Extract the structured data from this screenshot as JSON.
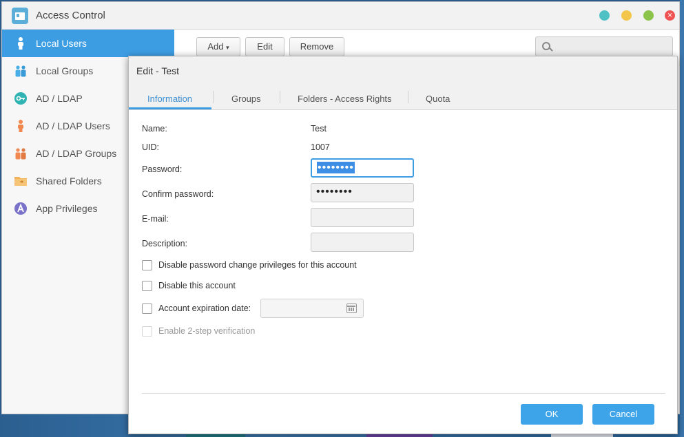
{
  "app": {
    "title": "Access Control"
  },
  "window_controls": {
    "colors": [
      "#4fc1c5",
      "#f3c54a",
      "#8cc34a",
      "#ef5454"
    ],
    "close_glyph": "✕"
  },
  "sidebar": {
    "items": [
      {
        "label": "Local Users",
        "icon": "user-icon",
        "active": true
      },
      {
        "label": "Local Groups",
        "icon": "users-icon"
      },
      {
        "label": "AD / LDAP",
        "icon": "key-icon"
      },
      {
        "label": "AD / LDAP Users",
        "icon": "user-icon"
      },
      {
        "label": "AD / LDAP Groups",
        "icon": "users-icon"
      },
      {
        "label": "Shared Folders",
        "icon": "folder-icon"
      },
      {
        "label": "App Privileges",
        "icon": "app-icon"
      }
    ]
  },
  "toolbar": {
    "add_label": "Add",
    "add_caret": "▾",
    "edit_label": "Edit",
    "remove_label": "Remove",
    "search_placeholder": ""
  },
  "dialog": {
    "title": "Edit - Test",
    "tabs": [
      {
        "label": "Information",
        "active": true
      },
      {
        "label": "Groups"
      },
      {
        "label": "Folders - Access Rights"
      },
      {
        "label": "Quota"
      }
    ],
    "fields": {
      "name_label": "Name:",
      "name_value": "Test",
      "uid_label": "UID:",
      "uid_value": "1007",
      "password_label": "Password:",
      "password_value": "••••••••",
      "confirm_label": "Confirm password:",
      "confirm_value": "••••••••",
      "email_label": "E-mail:",
      "email_value": "",
      "description_label": "Description:",
      "description_value": ""
    },
    "checkboxes": {
      "disable_pw_change": "Disable password change privileges for this account",
      "disable_account": "Disable this account",
      "expiration": "Account expiration date:",
      "two_step": "Enable 2-step verification"
    },
    "expiration_date_value": "",
    "ok_label": "OK",
    "cancel_label": "Cancel"
  },
  "colors": {
    "accent": "#3d9de3",
    "button": "#3ea4ea"
  }
}
